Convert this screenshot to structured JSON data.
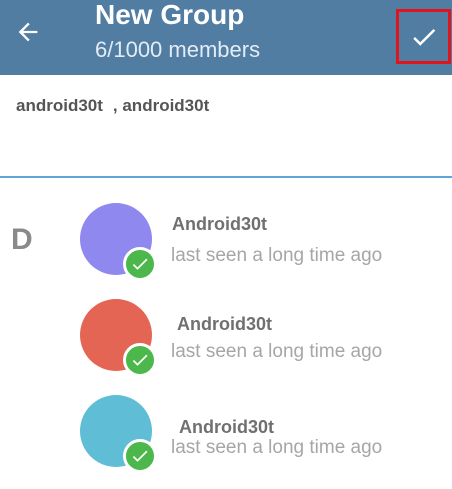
{
  "header": {
    "title": "New Group",
    "subtitle": "6/1000 members",
    "back_icon": "arrow-left-icon",
    "done_icon": "checkmark-icon",
    "bar_color": "#517da2",
    "highlight_color": "#e0141e"
  },
  "selected_chips": [
    "android30t",
    ", android30t"
  ],
  "section_letter": "D",
  "contacts": [
    {
      "name": "Android30t",
      "status": "last seen a long time ago",
      "avatar_color": "#8f88ef",
      "selected": true
    },
    {
      "name": "Android30t",
      "status": "last seen a long time ago",
      "avatar_color": "#e56555",
      "selected": true
    },
    {
      "name": "Android30t",
      "status": "last seen a long time ago",
      "avatar_color": "#5fbed5",
      "selected": true
    }
  ],
  "colors": {
    "divider": "#5ea6d8",
    "check_badge": "#4cb84b"
  }
}
